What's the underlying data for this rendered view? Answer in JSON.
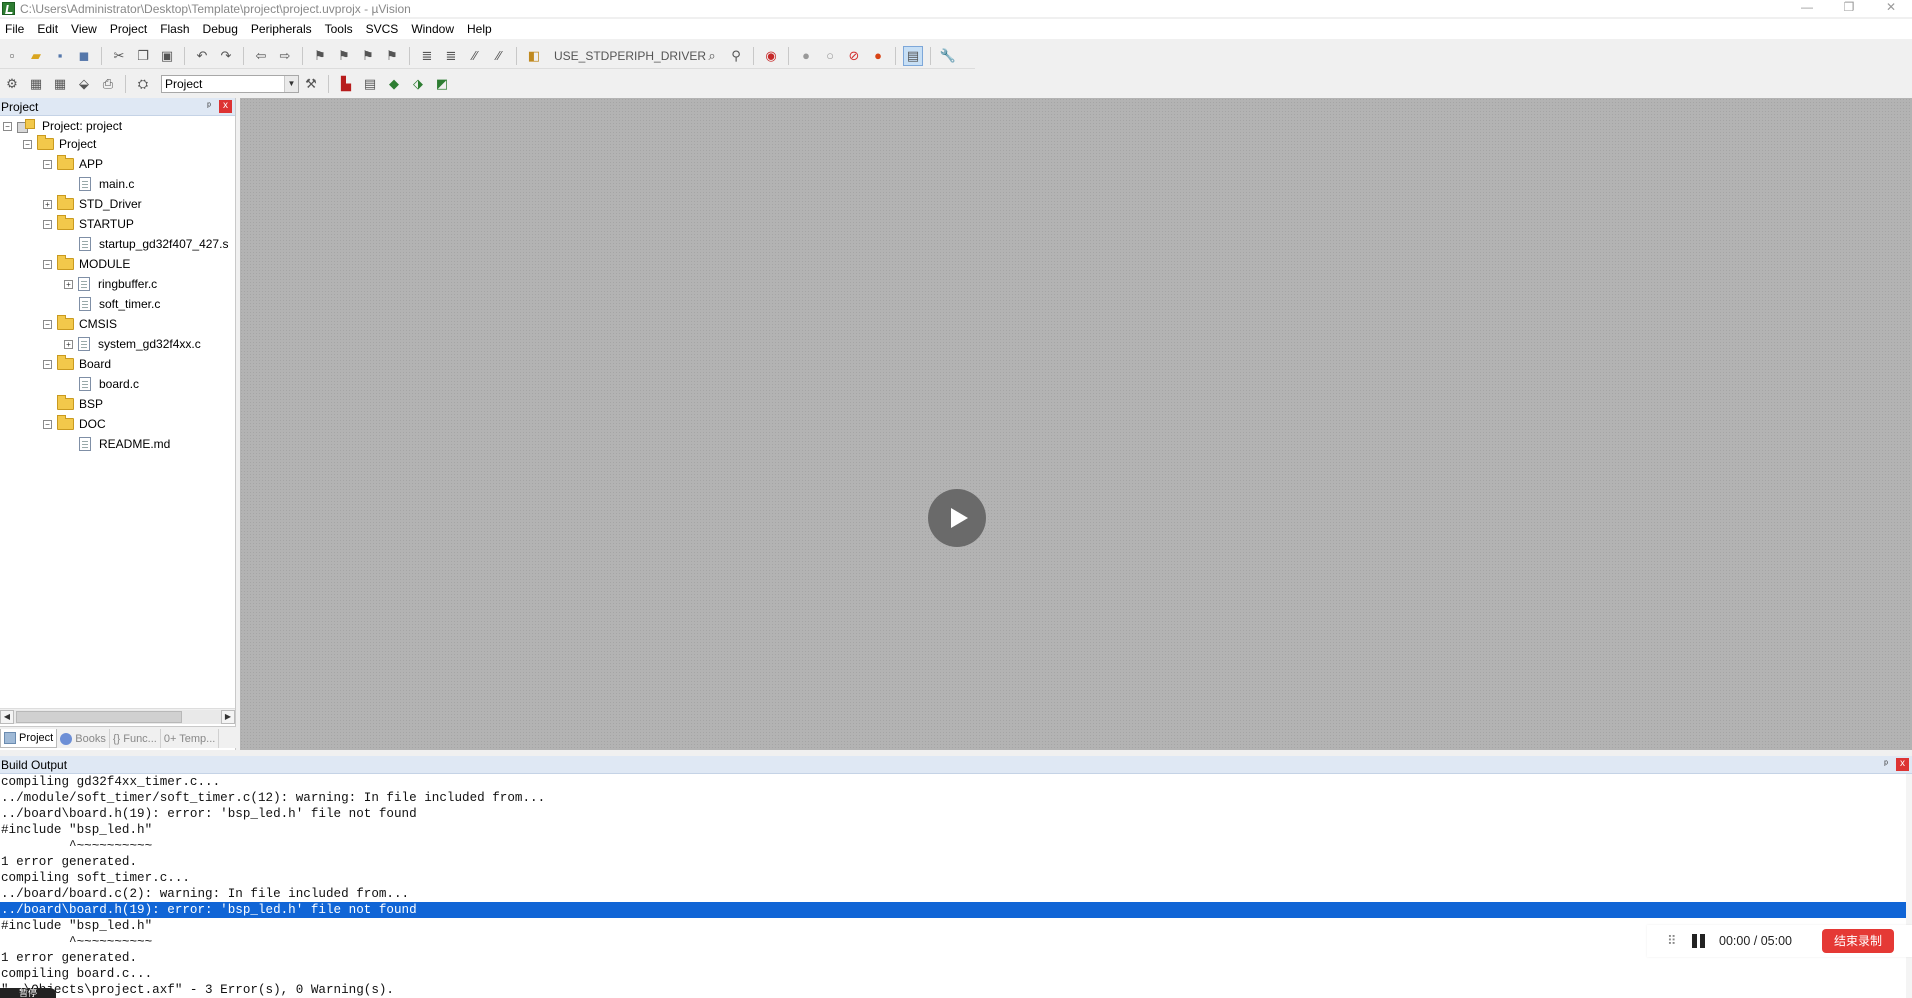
{
  "window": {
    "title": "C:\\Users\\Administrator\\Desktop\\Template\\project\\project.uvprojx - µVision",
    "minimize": "—",
    "restore": "❐",
    "close": "✕"
  },
  "menu": [
    "File",
    "Edit",
    "View",
    "Project",
    "Flash",
    "Debug",
    "Peripherals",
    "Tools",
    "SVCS",
    "Window",
    "Help"
  ],
  "toolbar": {
    "define_text": "USE_STDPERIPH_DRIVER",
    "target_select": "Project"
  },
  "project_panel": {
    "title": "Project",
    "pin": "ᵖ",
    "close": "x",
    "tree": {
      "root": "Project: project",
      "target": "Project",
      "groups": [
        {
          "name": "APP",
          "files": [
            "main.c"
          ]
        },
        {
          "name": "STD_Driver",
          "files": []
        },
        {
          "name": "STARTUP",
          "files": [
            "startup_gd32f407_427.s"
          ]
        },
        {
          "name": "MODULE",
          "files": [
            "ringbuffer.c",
            "soft_timer.c"
          ]
        },
        {
          "name": "CMSIS",
          "files": [
            "system_gd32f4xx.c"
          ]
        },
        {
          "name": "Board",
          "files": [
            "board.c"
          ]
        },
        {
          "name": "BSP",
          "files": []
        },
        {
          "name": "DOC",
          "files": [
            "README.md"
          ]
        }
      ]
    },
    "tabs": [
      "Project",
      "Books",
      "{} Func...",
      "0+ Temp..."
    ]
  },
  "build_output": {
    "title": "Build Output",
    "pin": "ᵖ",
    "close": "x",
    "lines": [
      "compiling gd32f4xx_timer.c...",
      "../module/soft_timer/soft_timer.c(12): warning: In file included from...",
      "../board\\board.h(19): error: 'bsp_led.h' file not found",
      "#include \"bsp_led.h\"",
      "         ^~~~~~~~~~~",
      "1 error generated.",
      "compiling soft_timer.c...",
      "../board/board.c(2): warning: In file included from...",
      "../board\\board.h(19): error: 'bsp_led.h' file not found",
      "#include \"bsp_led.h\"",
      "         ^~~~~~~~~~~",
      "1 error generated.",
      "compiling board.c...",
      "\"..\\Objects\\project.axf\" - 3 Error(s), 0 Warning(s)."
    ],
    "selected_index": 8
  },
  "recorder": {
    "grip": "⠿",
    "time": "00:00 / 05:00",
    "end_label": "结束录制",
    "pause_chip": "暂停"
  },
  "colors": {
    "selection": "#1065d6",
    "record_button": "#e53935"
  }
}
